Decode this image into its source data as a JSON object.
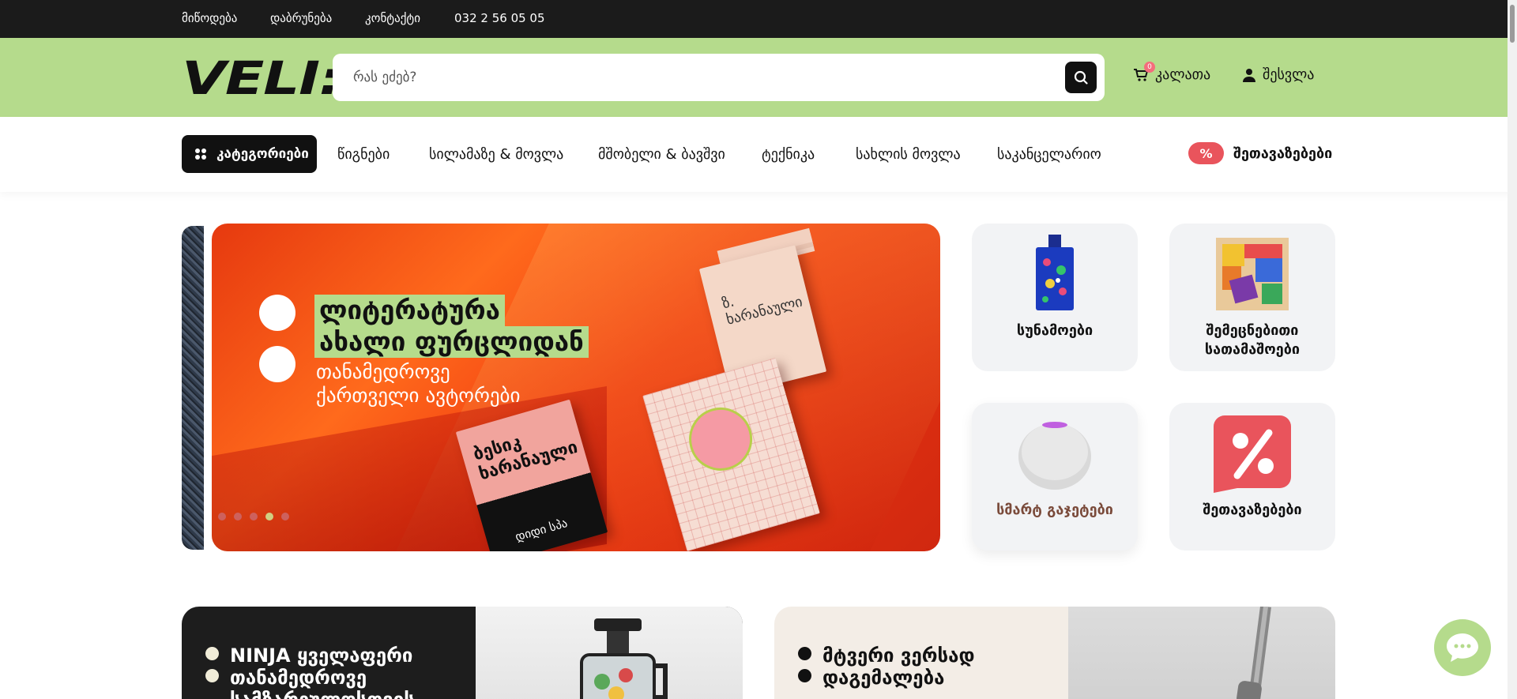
{
  "topbar": {
    "links": [
      "მიწოდება",
      "დაბრუნება",
      "კონტაქტი"
    ],
    "phone": "032 2 56 05 05"
  },
  "header": {
    "logo": "VELI:",
    "search_placeholder": "რას ეძებ?",
    "cart_label": "კალათა",
    "cart_count": "0",
    "login_label": "შესვლა"
  },
  "nav": {
    "categories_label": "კატეგორიები",
    "items": [
      "წიგნები",
      "სილამაზე & მოვლა",
      "მშობელი & ბავშვი",
      "ტექნიკა",
      "სახლის მოვლა",
      "საკანცელარიო"
    ],
    "deals_badge": "%",
    "deals_label": "შეთავაზებები"
  },
  "hero": {
    "title_line1": "ლიტერატურა",
    "title_line2": "ახალი ფურცლიდან",
    "sub_line1": "თანამედროვე",
    "sub_line2": "ქართველი ავტორები",
    "book1_title": "ბესიკ ხარანაული",
    "book1_author": "დიდი სპა",
    "book3_title": "ზ. ხარანაული",
    "slide_count": 5,
    "active_slide": 4
  },
  "tiles": [
    {
      "label": "სუნამოები",
      "icon": "perfume-bottle-icon"
    },
    {
      "label": "შემეცნებითი სათამაშოები",
      "icon": "puzzle-toy-icon"
    },
    {
      "label": "სმარტ გაჯეტები",
      "icon": "smart-speaker-icon",
      "color": "#7a4a3a"
    },
    {
      "label": "შეთავაზებები",
      "icon": "percent-badge-icon"
    }
  ],
  "promos": [
    {
      "line1": "NINJA ყველაფერი",
      "line2": "თანამედროვე",
      "line3": "სამზარეულოსთვის"
    },
    {
      "line1": "მტვერი ვერსად",
      "line2": "დაგემალება"
    }
  ],
  "colors": {
    "accent_green": "#b5db8c",
    "topbar": "#1b1b1b",
    "deals_red": "#e9545c",
    "cart_badge": "#f46d7c"
  }
}
